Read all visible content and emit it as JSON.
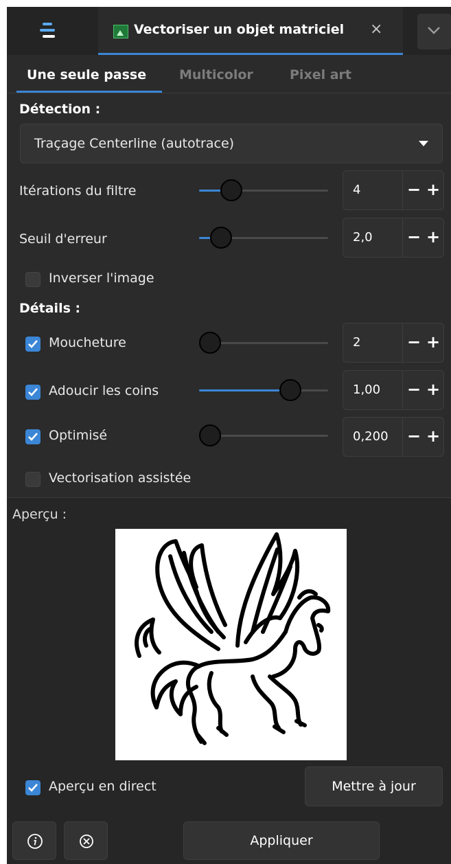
{
  "header": {
    "tab_title": "Vectoriser un objet matriciel",
    "close_glyph": "×"
  },
  "mode_tabs": [
    "Une seule passe",
    "Multicolor",
    "Pixel art"
  ],
  "detection": {
    "heading": "Détection :",
    "mode_value": "Traçage Centerline (autotrace)"
  },
  "params": {
    "filter_iterations": {
      "label": "Itérations du filtre",
      "value": "4",
      "level": 0.2
    },
    "error_threshold": {
      "label": "Seuil d'erreur",
      "value": "2,0",
      "level": 0.1
    },
    "invert": {
      "label": "Inverser l'image",
      "checked": false
    }
  },
  "details": {
    "heading": "Détails :",
    "speckles": {
      "label": "Moucheture",
      "value": "2",
      "checked": true,
      "level": 0.0
    },
    "smooth_corners": {
      "label": "Adoucir les coins",
      "value": "1,00",
      "checked": true,
      "level": 0.75
    },
    "optimize": {
      "label": "Optimisé",
      "value": "0,200",
      "checked": true,
      "level": 0.0
    },
    "assisted": {
      "label": "Vectorisation assistée",
      "checked": false
    }
  },
  "preview": {
    "heading": "Aperçu :",
    "live_label": "Aperçu en direct",
    "live_checked": true,
    "update_label": "Mettre à jour"
  },
  "footer": {
    "apply_label": "Appliquer"
  },
  "colors": {
    "accent": "#3b86d6",
    "panel_bg": "#2b2b2b",
    "text": "#e6e6e6"
  },
  "icons": {
    "dock_menu": "dock-menu-icon",
    "image_tab": "image-icon",
    "close": "close-icon",
    "chevron": "chevron-down-icon",
    "info": "info-icon",
    "reset": "reset-icon",
    "check": "checkmark-icon"
  }
}
